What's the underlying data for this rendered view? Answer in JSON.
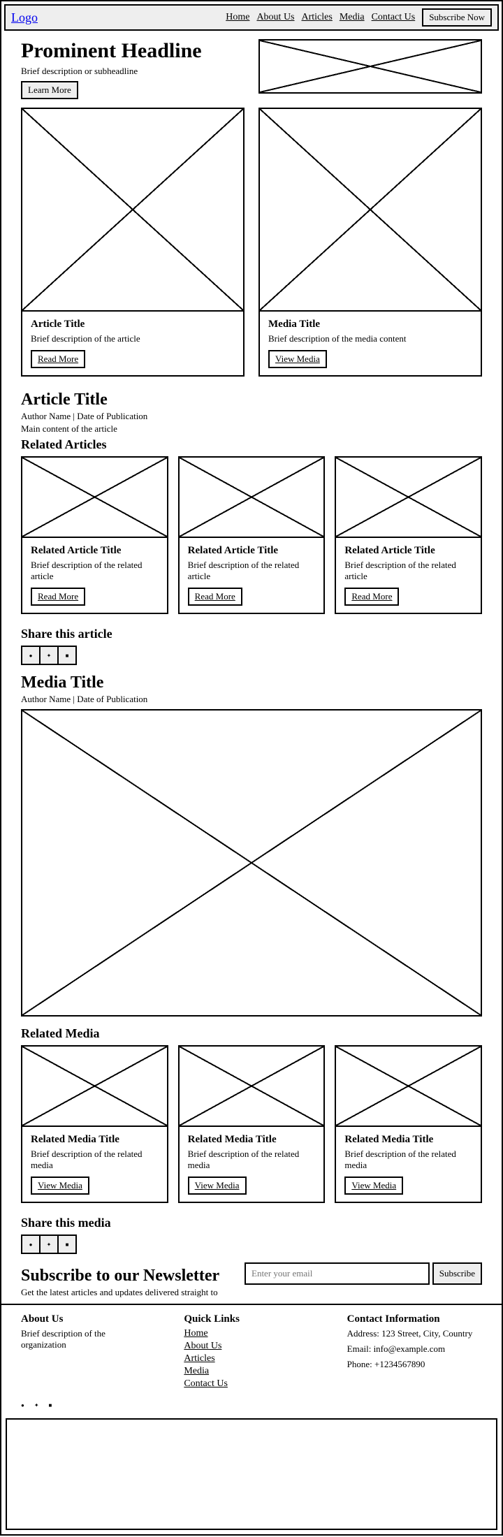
{
  "header": {
    "logo": "Logo",
    "nav": [
      "Home",
      "About Us",
      "Articles",
      "Media",
      "Contact Us"
    ],
    "subscribe": "Subscribe Now"
  },
  "hero": {
    "headline": "Prominent Headline",
    "sub": "Brief description or subheadline",
    "cta": "Learn More"
  },
  "featured": [
    {
      "title": "Article Title",
      "desc": "Brief description of the article",
      "cta": "Read More"
    },
    {
      "title": "Media Title",
      "desc": "Brief description of the media content",
      "cta": "View Media"
    }
  ],
  "article": {
    "title": "Article Title",
    "meta": "Author Name | Date of Publication",
    "body": "Main content of the article",
    "related_heading": "Related Articles",
    "related": [
      {
        "title": "Related Article Title",
        "desc": "Brief description of the related article",
        "cta": "Read More"
      },
      {
        "title": "Related Article Title",
        "desc": "Brief description of the related article",
        "cta": "Read More"
      },
      {
        "title": "Related Article Title",
        "desc": "Brief description of the related article",
        "cta": "Read More"
      }
    ],
    "share_heading": "Share this article"
  },
  "media": {
    "title": "Media Title",
    "meta": "Author Name | Date of Publication",
    "related_heading": "Related Media",
    "related": [
      {
        "title": "Related Media Title",
        "desc": "Brief description of the related media",
        "cta": "View Media"
      },
      {
        "title": "Related Media Title",
        "desc": "Brief description of the related media",
        "cta": "View Media"
      },
      {
        "title": "Related Media Title",
        "desc": "Brief description of the related media",
        "cta": "View Media"
      }
    ],
    "share_heading": "Share this media"
  },
  "newsletter": {
    "heading": "Subscribe to our Newsletter",
    "desc": "Get the latest articles and updates delivered straight to your inbox",
    "placeholder": "Enter your email",
    "cta": "Subscribe"
  },
  "footer": {
    "about_heading": "About Us",
    "about_desc": "Brief description of the organization",
    "quick_heading": "Quick Links",
    "quick_links": [
      "Home",
      "About Us",
      "Articles",
      "Media",
      "Contact Us"
    ],
    "contact_heading": "Contact Information",
    "address": "Address: 123 Street, City, Country",
    "email": "Email: info@example.com",
    "phone": "Phone: +1234567890"
  },
  "social_icons": [
    "●",
    "✦",
    "■"
  ]
}
